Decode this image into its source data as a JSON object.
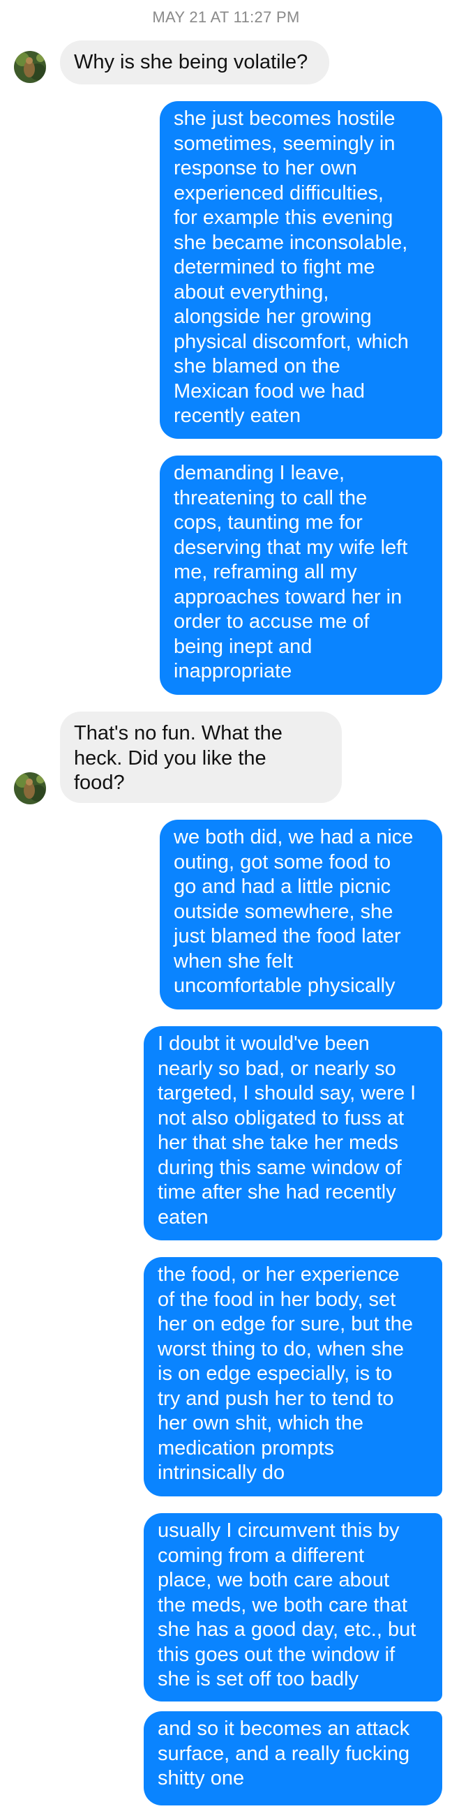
{
  "conversation": {
    "timestamp": "MAY 21 AT 11:27 PM",
    "contact_avatar_icon": "contact-avatar",
    "colors": {
      "incoming_bubble": "#efefef",
      "outgoing_bubble": "#0a84ff",
      "incoming_text": "#111111",
      "outgoing_text": "#ffffff",
      "timestamp_text": "#8a8a8a"
    },
    "messages": [
      {
        "direction": "incoming",
        "text": "Why is she being volatile?"
      },
      {
        "direction": "outgoing",
        "text": "she just becomes hostile\nsometimes, seemingly in\nresponse to her own\nexperienced difficulties,\nfor example this evening\nshe became inconsolable,\ndetermined to fight me\nabout everything,\nalongside her growing\nphysical discomfort, which\nshe blamed on the\nMexican food we had\nrecently eaten"
      },
      {
        "direction": "outgoing",
        "text": "demanding I leave,\nthreatening to call the\ncops, taunting me for\ndeserving that my wife left\nme, reframing all my\napproaches toward her in\norder to accuse me of\nbeing inept and\ninappropriate"
      },
      {
        "direction": "incoming",
        "text": "That's no fun. What the\nheck. Did you like the\nfood?"
      },
      {
        "direction": "outgoing",
        "text": "we both did, we had a nice\nouting, got some food to\ngo and had a little picnic\noutside somewhere, she\njust blamed the food later\nwhen she felt\nuncomfortable physically"
      },
      {
        "direction": "outgoing",
        "text": "I doubt it would've been\nnearly so bad, or nearly so\ntargeted, I should say, were I\nnot also obligated to fuss at\nher that she take her meds\nduring this same window of\ntime after she had recently\neaten"
      },
      {
        "direction": "outgoing",
        "text": "the food, or her experience\nof the food in her body, set\nher on edge for sure, but the\nworst thing to do, when she\nis on edge especially, is to\ntry and push her to tend to\nher own shit, which the\nmedication prompts\nintrinsically do"
      },
      {
        "direction": "outgoing",
        "text": "usually I circumvent this by\ncoming from a different\nplace, we both care about\nthe meds, we both care that\nshe has a good day, etc., but\nthis goes out the window if\nshe is set off too badly"
      },
      {
        "direction": "outgoing",
        "text": "and so it becomes an attack\nsurface, and a really fucking\nshitty one"
      }
    ]
  }
}
